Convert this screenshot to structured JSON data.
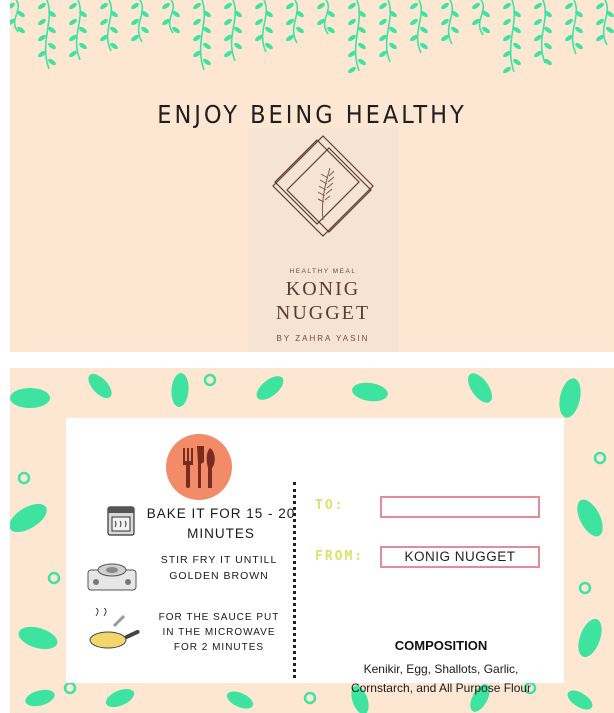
{
  "front": {
    "headline": "ENJOY BEING HEALTHY",
    "logo": {
      "tagline": "HEALTHY MEAL",
      "brand_line1": "KONIG",
      "brand_line2": "NUGGET",
      "author": "BY ZAHRA YASIN"
    }
  },
  "back": {
    "steps": [
      {
        "icon": "oven-icon",
        "text": "BAKE IT FOR 15 - 20 MINUTES"
      },
      {
        "icon": "stove-icon",
        "text": "STIR FRY IT UNTILL GOLDEN BROWN"
      },
      {
        "icon": "frying-pan-icon",
        "text": "FOR THE SAUCE PUT IN THE MICROWAVE FOR 2 MINUTES"
      }
    ],
    "to_label": "TO:",
    "to_value": "",
    "from_label": "FROM:",
    "from_value": "KONIG NUGGET",
    "composition_title": "COMPOSITION",
    "composition_text": "Kenikir, Egg, Shallots, Garlic, Cornstarch, and All Purpose Flour"
  },
  "colors": {
    "card_background": "#fde7d3",
    "leaf_green": "#3ee3a0",
    "icon_plate": "#f28c68",
    "field_border": "#e58a9b",
    "label_yellow": "#d9e36a",
    "logo_brown": "#5c3b36"
  }
}
